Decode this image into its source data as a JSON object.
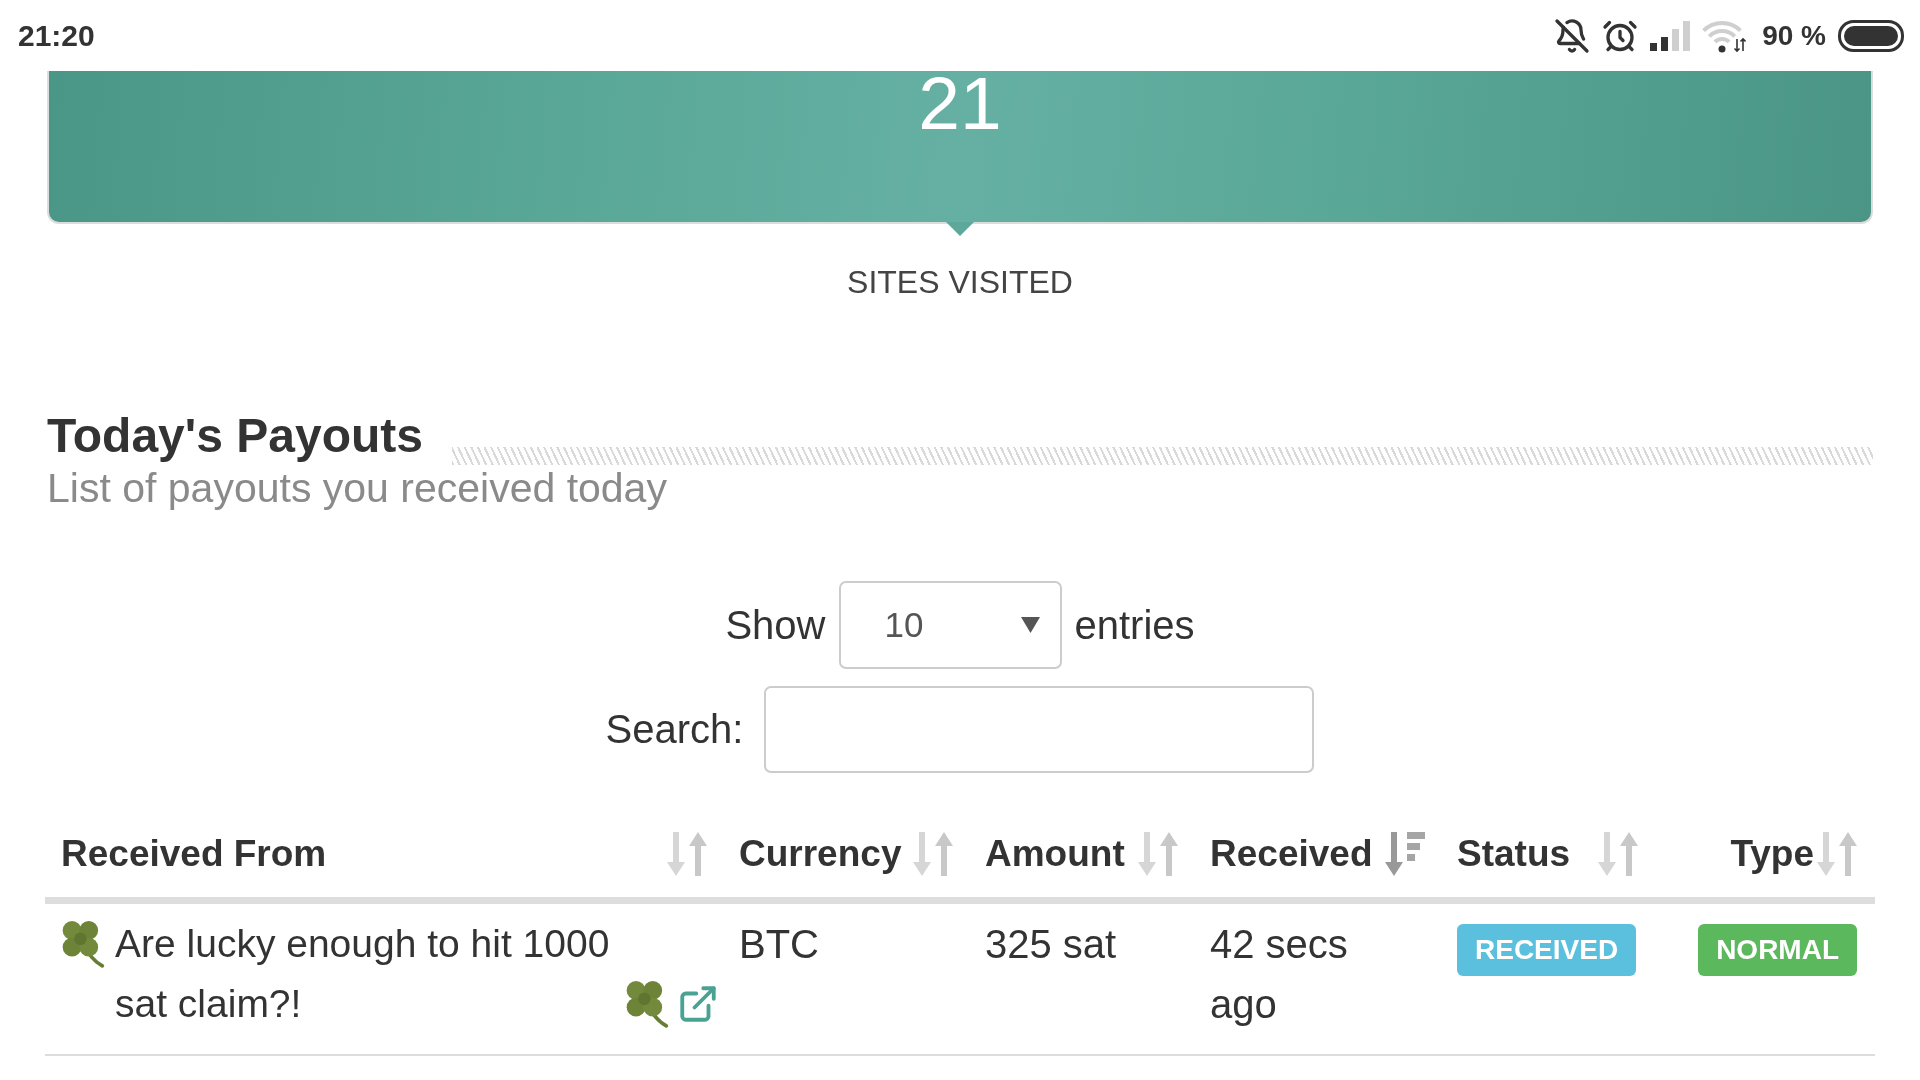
{
  "status_bar": {
    "time": "21:20",
    "battery": "90 %"
  },
  "stat_card": {
    "value": "21",
    "label": "SITES VISITED"
  },
  "payouts": {
    "title": "Today's Payouts",
    "subtitle": "List of payouts you received today",
    "length_menu": {
      "label_before": "Show",
      "value": "10",
      "label_after": "entries"
    },
    "search": {
      "label": "Search:"
    },
    "table": {
      "columns": [
        {
          "label": "Received From",
          "sorted": false
        },
        {
          "label": "Currency",
          "sorted": false
        },
        {
          "label": "Amount",
          "sorted": false
        },
        {
          "label": "Received",
          "sorted": true
        },
        {
          "label": "Status",
          "sorted": false
        },
        {
          "label": "Type",
          "sorted": false
        }
      ],
      "rows": [
        {
          "received_from": "Are lucky enough to hit 1000 sat claim?!",
          "currency": "BTC",
          "amount": "325 sat",
          "received": "42 secs ago",
          "status": {
            "label": "RECEIVED",
            "color": "#5bc0de"
          },
          "type": {
            "label": "NORMAL",
            "color": "#5cb85c"
          }
        }
      ]
    }
  }
}
